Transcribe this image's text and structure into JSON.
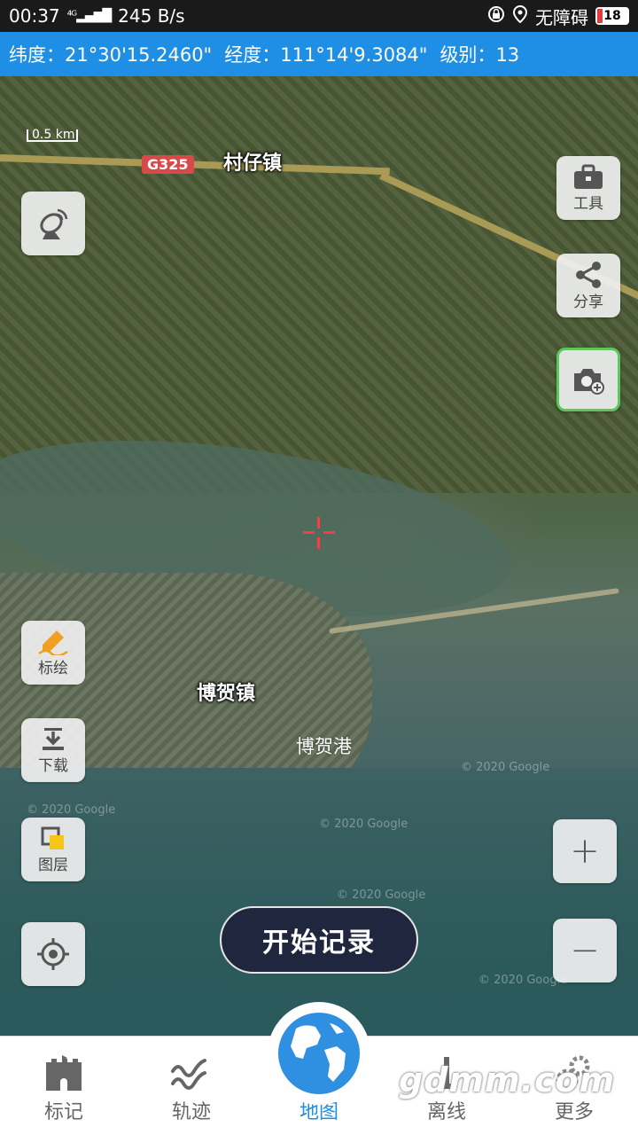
{
  "status": {
    "time": "00:37",
    "network": "4G",
    "speed": "245 B/s",
    "accessibility": "无障碍",
    "battery": "18",
    "icons": [
      "signal-icon",
      "lock-icon",
      "location-icon",
      "battery-icon"
    ]
  },
  "coords": {
    "lat_label": "纬度：",
    "lat_value": "21°30'15.2460\"",
    "lon_label": "经度：",
    "lon_value": "111°14'9.3084\"",
    "level_label": "级别：",
    "level_value": "13"
  },
  "map": {
    "scale": "0.5 km",
    "road_label": "G325",
    "places": {
      "town1": "村仔镇",
      "town2": "博贺镇",
      "port": "博贺港"
    },
    "watermark": "© 2020 Google"
  },
  "right_tools": {
    "tools_label": "工具",
    "share_label": "分享"
  },
  "left_tools": {
    "draw_label": "标绘",
    "download_label": "下载",
    "layers_label": "图层"
  },
  "zoom": {
    "in": "+",
    "out": "−"
  },
  "record_button": "开始记录",
  "nav": {
    "items": [
      {
        "label": "标记",
        "icon": "castle-icon"
      },
      {
        "label": "轨迹",
        "icon": "track-icon"
      },
      {
        "label": "地图",
        "icon": "globe-icon"
      },
      {
        "label": "离线",
        "icon": "offline-icon"
      },
      {
        "label": "更多",
        "icon": "gear-icon"
      }
    ],
    "active": "地图"
  },
  "brand_watermark": "gdmm.com",
  "colors": {
    "accent": "#1f8fe6",
    "record_bg": "#21263f",
    "camera_border": "#5ec65a",
    "crosshair": "#ff3b3b"
  }
}
